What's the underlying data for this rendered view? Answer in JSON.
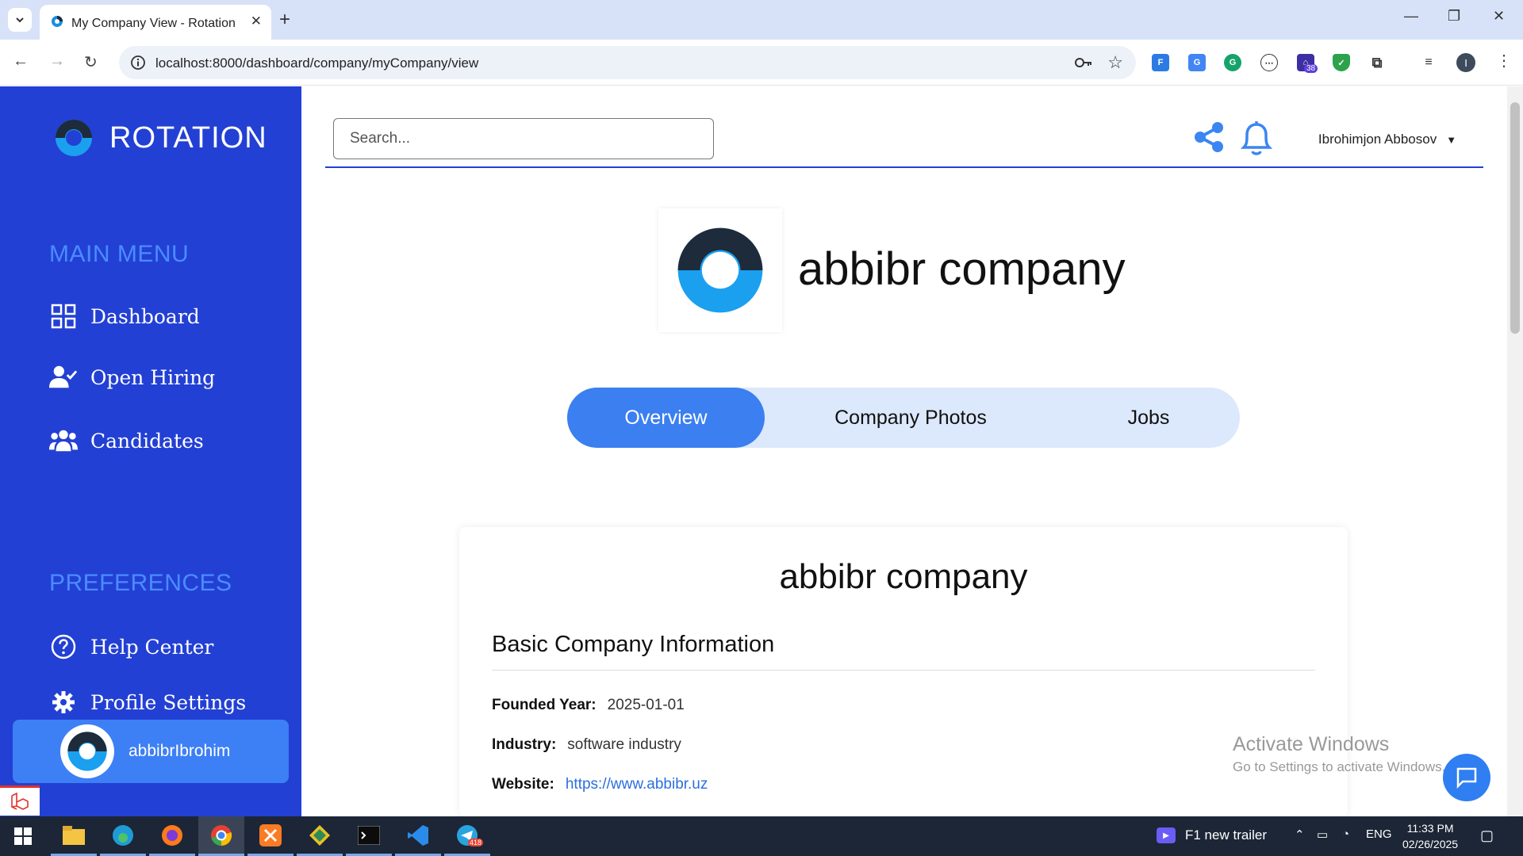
{
  "browser": {
    "tab_title": "My Company View - Rotation",
    "url": "localhost:8000/dashboard/company/myCompany/view",
    "extension_badge": "38",
    "profile_initial": "I"
  },
  "sidebar": {
    "brand": "ROTATION",
    "main_menu_heading": "MAIN MENU",
    "main_items": [
      {
        "label": "Dashboard",
        "icon": "grid-icon"
      },
      {
        "label": "Open Hiring",
        "icon": "user-check-icon"
      },
      {
        "label": "Candidates",
        "icon": "users-icon"
      }
    ],
    "preferences_heading": "PREFERENCES",
    "pref_items": [
      {
        "label": "Help Center",
        "icon": "question-circle-icon"
      },
      {
        "label": "Profile Settings",
        "icon": "gear-icon"
      }
    ],
    "user_card_name": "abbibrIbrohim"
  },
  "header": {
    "search_placeholder": "Search...",
    "user_name": "Ibrohimjon Abbosov"
  },
  "company": {
    "name": "abbibr company",
    "tabs": [
      "Overview",
      "Company Photos",
      "Jobs"
    ],
    "active_tab": "Overview",
    "card_title": "abbibr company",
    "section_title": "Basic Company Information",
    "fields": [
      {
        "label": "Founded Year:",
        "value": "2025-01-01"
      },
      {
        "label": "Industry:",
        "value": "software industry"
      },
      {
        "label": "Website:",
        "value": "https://www.abbibr.uz"
      }
    ]
  },
  "watermark": {
    "title": "Activate Windows",
    "subtitle": "Go to Settings to activate Windows."
  },
  "taskbar": {
    "telegram_badge": "418",
    "news": "F1 new trailer",
    "language": "ENG",
    "time": "11:33 PM",
    "date": "02/26/2025"
  },
  "colors": {
    "sidebar": "#2340d4",
    "accent": "#3b7ff0",
    "heading_blue": "#4a8cff",
    "tabs_bg": "#dce8fb"
  }
}
